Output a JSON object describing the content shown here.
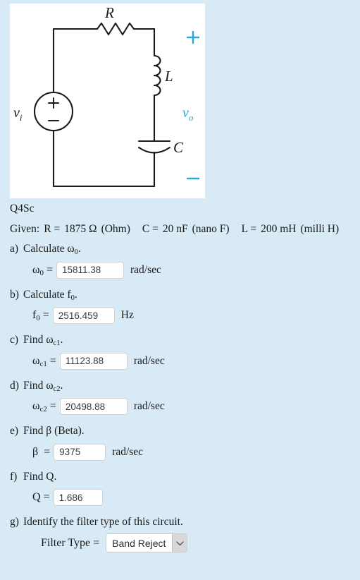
{
  "page": {
    "background_color": "#d8eaf5",
    "question_id": "Q4Sc"
  },
  "figure": {
    "name": "rlc-series-circuit",
    "background_color": "#ffffff",
    "accent_color": "#29a8d8",
    "wire_color": "#1a1a1a",
    "labels": {
      "resistor": "R",
      "inductor": "L",
      "capacitor": "C",
      "source": "v",
      "source_sub": "i",
      "output": "v",
      "output_sub": "o",
      "source_plus": "+",
      "source_minus": "−",
      "out_plus": "+",
      "out_minus": "−"
    }
  },
  "given": {
    "prefix": "Given:",
    "r_label": "R =",
    "r_value": "1875 Ω",
    "r_unit": "(Ohm)",
    "c_label": "C =",
    "c_value": "20 nF",
    "c_unit": "(nano F)",
    "l_label": "L =",
    "l_value": "200 mH",
    "l_unit": "(milli H)"
  },
  "questions": [
    {
      "marker": "a)",
      "prompt_text": "Calculate ",
      "prompt_symbol": "ω",
      "prompt_sub": "0",
      "prompt_suffix": ".",
      "eq_symbol": "ω",
      "eq_sub": "0",
      "eq_sign": "=",
      "value": "15811.38",
      "unit": "rad/sec"
    },
    {
      "marker": "b)",
      "prompt_text": "Calculate ",
      "prompt_symbol": "f",
      "prompt_sub": "0",
      "prompt_suffix": ".",
      "eq_symbol": "f",
      "eq_sub": "0",
      "eq_sign": "=",
      "value": "2516.459",
      "unit": "Hz"
    },
    {
      "marker": "c)",
      "prompt_text": "Find ",
      "prompt_symbol": "ω",
      "prompt_sub": "c1",
      "prompt_suffix": ".",
      "eq_symbol": "ω",
      "eq_sub": "c1",
      "eq_sign": "=",
      "value": "11123.88",
      "unit": "rad/sec"
    },
    {
      "marker": "d)",
      "prompt_text": "Find ",
      "prompt_symbol": "ω",
      "prompt_sub": "c2",
      "prompt_suffix": ".",
      "eq_symbol": "ω",
      "eq_sub": "c2",
      "eq_sign": "=",
      "value": "20498.88",
      "unit": "rad/sec"
    },
    {
      "marker": "e)",
      "prompt_text": "Find β (Beta).",
      "prompt_symbol": "",
      "prompt_sub": "",
      "prompt_suffix": "",
      "eq_symbol": "β",
      "eq_sub": "",
      "eq_sign": "=",
      "value": "9375",
      "unit": "rad/sec"
    },
    {
      "marker": "f)",
      "prompt_text": "Find Q.",
      "prompt_symbol": "",
      "prompt_sub": "",
      "prompt_suffix": "",
      "eq_symbol": "Q",
      "eq_sub": "",
      "eq_sign": "=",
      "value": "1.686",
      "unit": ""
    },
    {
      "marker": "g)",
      "prompt_text": "Identify the filter type of this circuit.",
      "prompt_symbol": "",
      "prompt_sub": "",
      "prompt_suffix": "",
      "eq_symbol": "Filter Type",
      "eq_sub": "",
      "eq_sign": "=",
      "value": "Band Reject",
      "unit": ""
    }
  ],
  "filter_select": {
    "selected": "Band Reject",
    "arrow_icon": "chevron-down-icon"
  }
}
